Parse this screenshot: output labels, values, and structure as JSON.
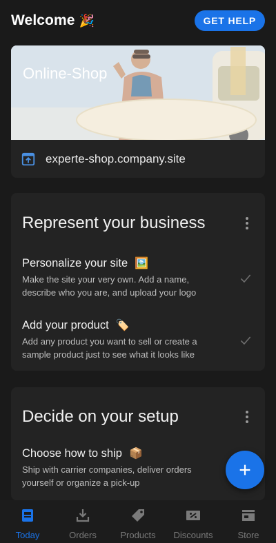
{
  "header": {
    "title": "Welcome",
    "title_emoji": "🎉",
    "help_label": "GET HELP"
  },
  "shop": {
    "banner_title": "Online-Shop",
    "url": "experte-shop.company.site"
  },
  "business_card": {
    "title": "Represent your business",
    "tasks": [
      {
        "title": "Personalize your site",
        "emoji": "🖼️",
        "description": "Make the site your very own. Add a name, describe who you are, and upload your logo",
        "done": true
      },
      {
        "title": "Add your product",
        "emoji": "🏷️",
        "description": "Add any product you want to sell or create a sample product just to see what it looks like",
        "done": true
      }
    ]
  },
  "setup_card": {
    "title": "Decide on your setup",
    "tasks": [
      {
        "title": "Choose how to ship",
        "emoji": "📦",
        "description": "Ship with carrier companies, deliver orders yourself or organize a pick-up"
      }
    ]
  },
  "nav": {
    "items": [
      {
        "label": "Today",
        "icon": "today-icon",
        "active": true
      },
      {
        "label": "Orders",
        "icon": "orders-icon"
      },
      {
        "label": "Products",
        "icon": "products-tag-icon"
      },
      {
        "label": "Discounts",
        "icon": "discounts-icon"
      },
      {
        "label": "Store",
        "icon": "store-icon"
      }
    ]
  },
  "colors": {
    "accent": "#1a73e8",
    "background": "#1a1a1a",
    "card": "#232323"
  }
}
